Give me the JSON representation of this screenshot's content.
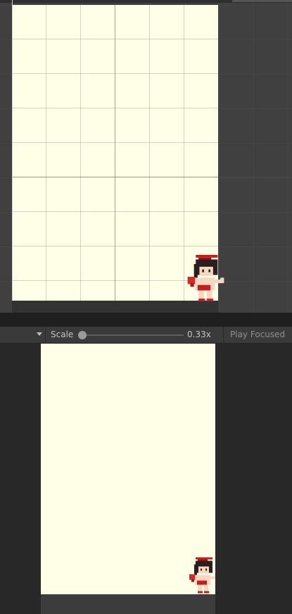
{
  "toolbar": {
    "scale_label": "Scale",
    "scale_value": "0.33x",
    "scale_fraction": 0.0,
    "play_focused_label": "Play Focused"
  },
  "icons": {
    "dropdown": "chevron-down-icon",
    "character": "pixel-character-sprite"
  },
  "colors": {
    "canvas_background": "#fffee6",
    "editor_background": "#3c3c3c",
    "game_view_background": "#282828"
  }
}
